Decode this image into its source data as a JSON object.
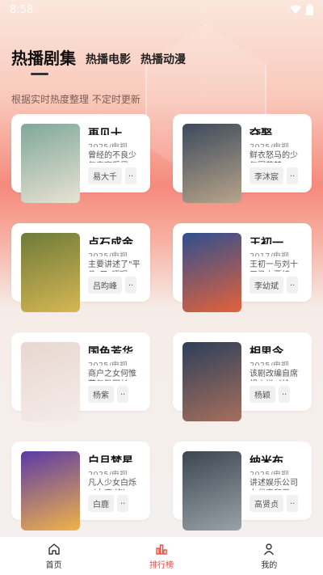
{
  "status_bar": {
    "time": "8:58"
  },
  "tabs": [
    {
      "label": "热播剧集",
      "active": true
    },
    {
      "label": "热播电影",
      "active": false
    },
    {
      "label": "热播动漫",
      "active": false
    }
  ],
  "subtitle": "根据实时热度整理 不定时更新",
  "cards": [
    {
      "title": "再见十八...",
      "meta": "2025/电视剧...",
      "desc": "曾经的不良少年宋宸受恩...",
      "actor": "易大千",
      "more": "..",
      "poster_colors": [
        "#7fa89a",
        "#e9e2d3"
      ]
    },
    {
      "title": "夺娶",
      "meta": "2025/电视剧...",
      "desc": "鲜衣怒马的少年军萧楚...",
      "actor": "李沐宸",
      "more": "..",
      "poster_colors": [
        "#3c4a5c",
        "#b8a48a"
      ]
    },
    {
      "title": "点石成金",
      "meta": "2025/电视剧...",
      "desc": "主要讲述了\"平凡\"又\"耀眼\"...",
      "actor": "吕昀峰",
      "more": "..",
      "poster_colors": [
        "#6e7b3a",
        "#d6b653"
      ]
    },
    {
      "title": "王初一与...",
      "meta": "2017/电视剧...",
      "desc": "王初一与刘十五马上要结...",
      "actor": "李幼斌",
      "more": "..",
      "poster_colors": [
        "#2f4f8f",
        "#e3623a"
      ]
    },
    {
      "title": "国色芳华",
      "meta": "2025/电视剧...",
      "desc": "商户之女何惟芳与雅冠长...",
      "actor": "杨紫",
      "more": "..",
      "poster_colors": [
        "#e8d7d0",
        "#f4ece8"
      ]
    },
    {
      "title": "相思令",
      "meta": "2025/电视剧...",
      "desc": "该剧改编自席绢小说《抢...",
      "actor": "杨颖",
      "more": "..",
      "poster_colors": [
        "#2e3f5a",
        "#a56f5c"
      ]
    },
    {
      "title": "白月梵星",
      "meta": "2025/电视剧...",
      "desc": "凡人少女白烁（白鹿 饰）...",
      "actor": "白鹿",
      "more": "..",
      "poster_colors": [
        "#5b3aa6",
        "#f0b34a"
      ]
    },
    {
      "title": "纳米布",
      "meta": "2025/电视剧...",
      "desc": "讲述娱乐公司女代表和男...",
      "actor": "高贤贞",
      "more": "..",
      "poster_colors": [
        "#3d4650",
        "#9aa2a8"
      ]
    }
  ],
  "bottom_nav": [
    {
      "label": "首页",
      "icon": "home-icon",
      "active": false
    },
    {
      "label": "排行榜",
      "icon": "chart-icon",
      "active": true
    },
    {
      "label": "我的",
      "icon": "user-icon",
      "active": false
    }
  ],
  "colors": {
    "accent": "#e94b3c"
  }
}
